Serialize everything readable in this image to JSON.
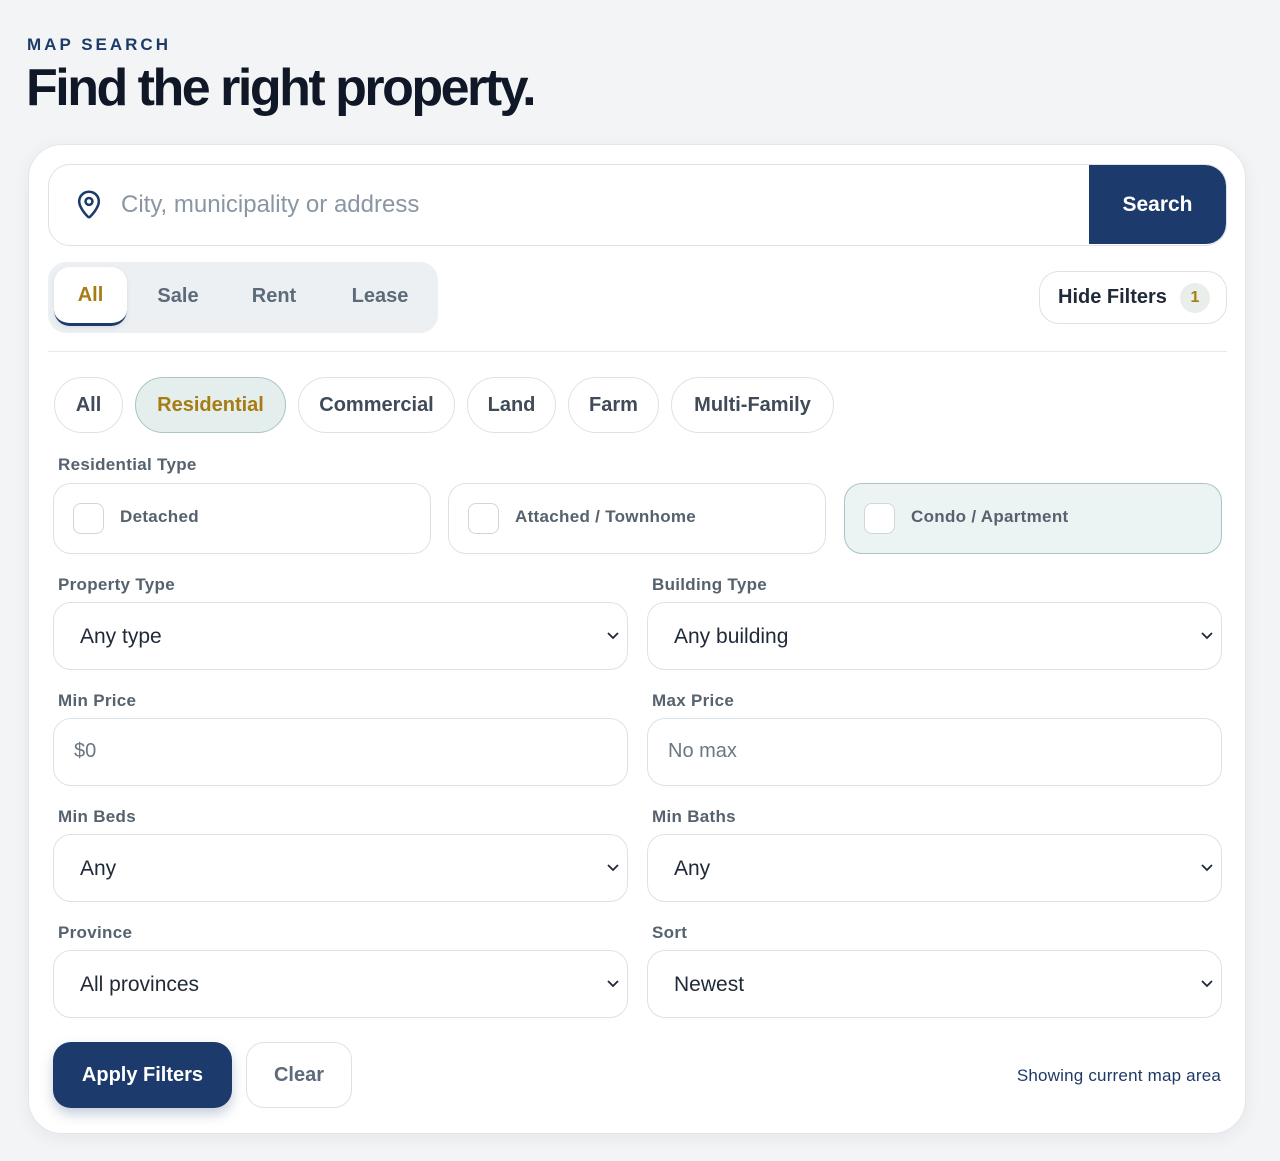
{
  "header": {
    "eyebrow": "MAP SEARCH",
    "title": "Find the right property."
  },
  "search": {
    "placeholder": "City, municipality or address",
    "value": "",
    "button_label": "Search",
    "icon": "map-pin-icon"
  },
  "listing_tabs": [
    {
      "label": "All",
      "active": true
    },
    {
      "label": "Sale",
      "active": false
    },
    {
      "label": "Rent",
      "active": false
    },
    {
      "label": "Lease",
      "active": false
    }
  ],
  "hide_filters": {
    "label": "Hide Filters",
    "count": "1"
  },
  "category_chips": [
    {
      "label": "All",
      "active": false
    },
    {
      "label": "Residential",
      "active": true
    },
    {
      "label": "Commercial",
      "active": false
    },
    {
      "label": "Land",
      "active": false
    },
    {
      "label": "Farm",
      "active": false
    },
    {
      "label": "Multi-Family",
      "active": false
    }
  ],
  "residential_type": {
    "label": "Residential Type",
    "options": [
      {
        "label": "Detached",
        "checked": false,
        "highlighted": false
      },
      {
        "label": "Attached / Townhome",
        "checked": false,
        "highlighted": false
      },
      {
        "label": "Condo / Apartment",
        "checked": false,
        "highlighted": true
      }
    ]
  },
  "filters": {
    "property_type": {
      "label": "Property Type",
      "value": "Any type"
    },
    "building_type": {
      "label": "Building Type",
      "value": "Any building"
    },
    "min_price": {
      "label": "Min Price",
      "placeholder": "$0",
      "value": ""
    },
    "max_price": {
      "label": "Max Price",
      "placeholder": "No max",
      "value": ""
    },
    "min_beds": {
      "label": "Min Beds",
      "value": "Any"
    },
    "min_baths": {
      "label": "Min Baths",
      "value": "Any"
    },
    "province": {
      "label": "Province",
      "value": "All provinces"
    },
    "sort": {
      "label": "Sort",
      "value": "Newest"
    }
  },
  "actions": {
    "apply_label": "Apply Filters",
    "clear_label": "Clear",
    "status_text": "Showing current map area"
  },
  "colors": {
    "brand_navy": "#1c3a6b",
    "accent_gold": "#a67c13",
    "active_chip_bg": "#e4eeed"
  }
}
